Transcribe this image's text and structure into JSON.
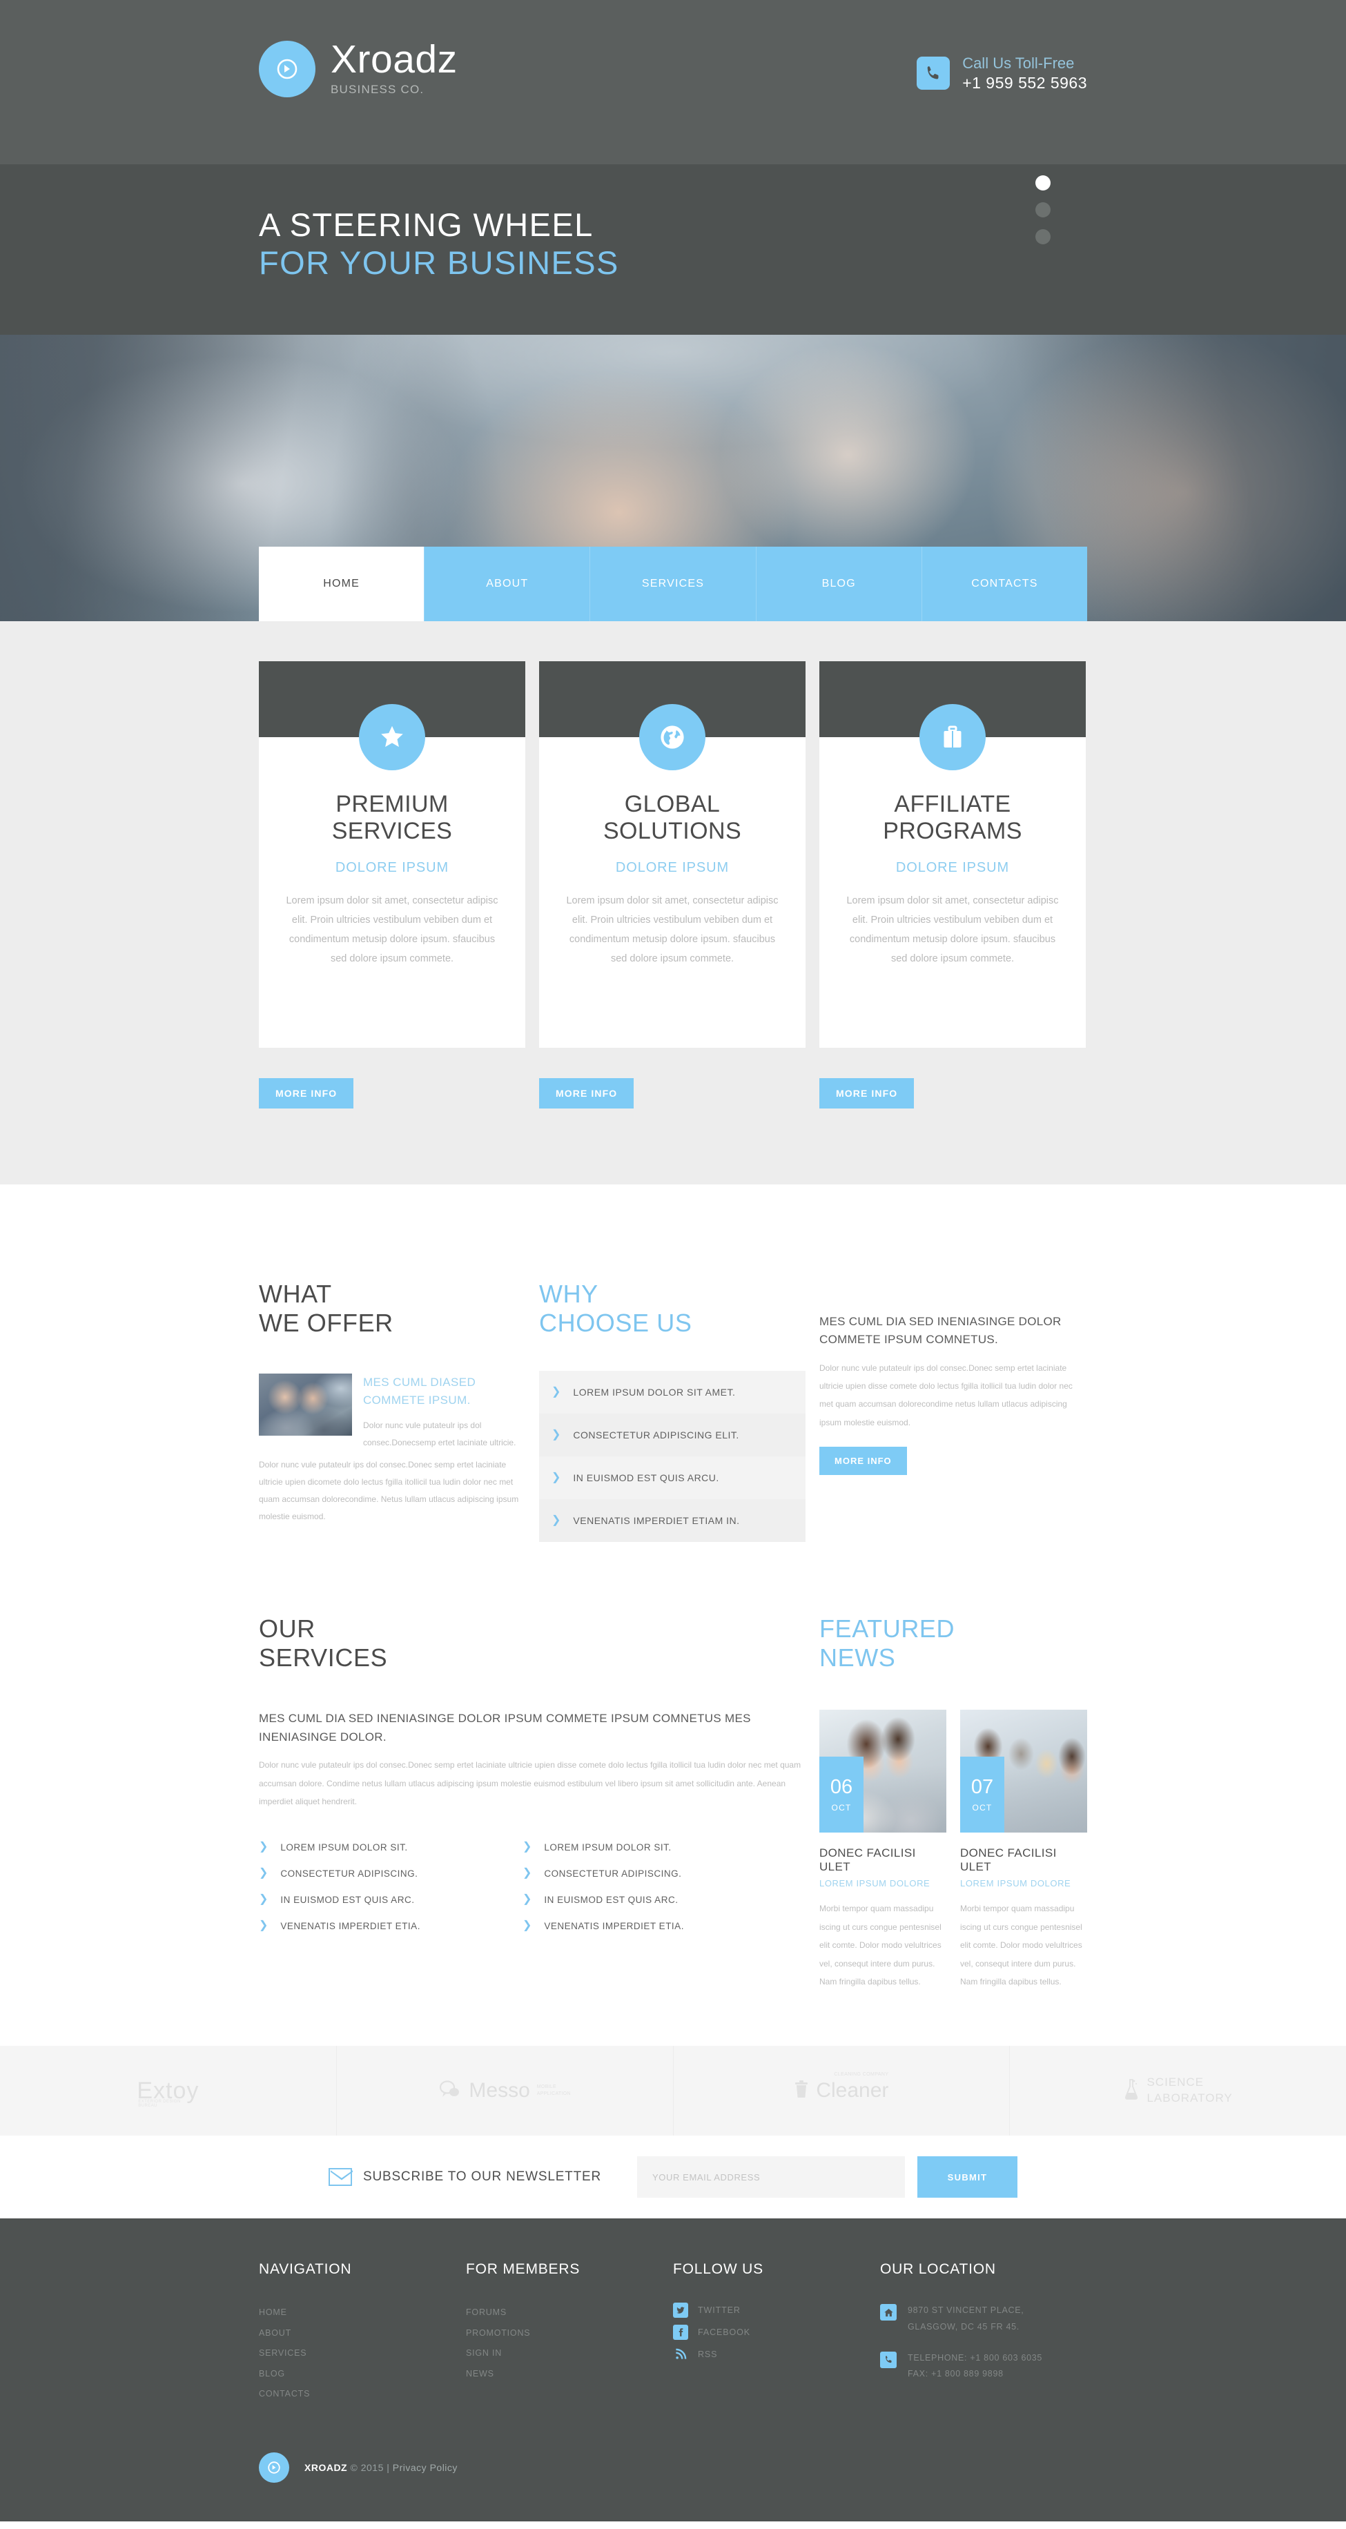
{
  "colors": {
    "accent": "#7ecbf5",
    "dark": "#4e5251",
    "header_dark": "#5b5f5e",
    "light_gray": "#ededed"
  },
  "header": {
    "brand_name": "Xroadz",
    "brand_sub": "BUSINESS CO.",
    "call_label": "Call Us Toll-Free",
    "call_number": "+1 959 552 5963"
  },
  "hero": {
    "line1": "A STEERING WHEEL",
    "line2": "FOR YOUR BUSINESS",
    "slides": 3,
    "active_slide": 1
  },
  "nav": {
    "items": [
      {
        "label": "HOME",
        "active": true
      },
      {
        "label": "ABOUT",
        "active": false
      },
      {
        "label": "SERVICES",
        "active": false
      },
      {
        "label": "BLOG",
        "active": false
      },
      {
        "label": "CONTACTS",
        "active": false
      }
    ]
  },
  "cards": [
    {
      "icon": "star-icon",
      "title_line1": "PREMIUM",
      "title_line2": "SERVICES",
      "subtitle": "DOLORE IPSUM",
      "text": "Lorem ipsum dolor sit amet, consectetur adipisc elit. Proin ultricies vestibulum vebiben dum et condimentum metusip dolore ipsum. sfaucibus sed dolore ipsum commete.",
      "button": "MORE INFO"
    },
    {
      "icon": "globe-icon",
      "title_line1": "GLOBAL",
      "title_line2": "SOLUTIONS",
      "subtitle": "DOLORE IPSUM",
      "text": "Lorem ipsum dolor sit amet, consectetur adipisc elit. Proin ultricies vestibulum vebiben dum et condimentum metusip dolore ipsum. sfaucibus sed dolore ipsum commete.",
      "button": "MORE INFO"
    },
    {
      "icon": "briefcase-icon",
      "title_line1": "AFFILIATE",
      "title_line2": "PROGRAMS",
      "subtitle": "DOLORE IPSUM",
      "text": "Lorem ipsum dolor sit amet, consectetur adipisc elit. Proin ultricies vestibulum vebiben dum et condimentum metusip dolore ipsum. sfaucibus sed dolore ipsum commete.",
      "button": "MORE INFO"
    }
  ],
  "offer": {
    "heading_line1": "WHAT",
    "heading_line2": "WE OFFER",
    "item_heading": "MES CUML DIASED COMMETE IPSUM.",
    "item_text": "Dolor nunc vule putateulr ips dol consec.Donecsemp ertet laciniate ultricie.",
    "body_text": "Dolor nunc vule putateulr ips dol consec.Donec semp ertet laciniate ultricie upien dicomete dolo lectus fgilla itollicil tua ludin dolor nec met quam accumsan dolorecondime. Netus lullam utlacus adipiscing ipsum molestie euismod."
  },
  "choose": {
    "heading_line1": "WHY",
    "heading_line2": "CHOOSE US",
    "items": [
      "LOREM IPSUM DOLOR SIT AMET.",
      "CONSECTETUR ADIPISCING ELIT.",
      "IN EUISMOD EST QUIS ARCU.",
      "VENENATIS IMPERDIET ETIAM IN."
    ]
  },
  "offer_right": {
    "heading": "MES CUML DIA SED INENIASINGE DOLOR COMMETE IPSUM COMNETUS.",
    "text": "Dolor nunc vule putateulr ips dol consec.Donec semp ertet laciniate ultricie upien disse comete dolo lectus fgilla itollicil tua ludin dolor nec met quam accumsan dolorecondime netus lullam utlacus adipiscing ipsum molestie euismod.",
    "button": "MORE INFO"
  },
  "services": {
    "heading_line1": "OUR",
    "heading_line2": "SERVICES",
    "subheading": "MES CUML DIA SED INENIASINGE DOLOR IPSUM COMMETE IPSUM COMNETUS MES INENIASINGE DOLOR.",
    "text": "Dolor nunc vule putateulr ips dol consec.Donec semp ertet laciniate ultricie upien disse comete dolo lectus fgilla itollicil tua ludin dolor nec met quam accumsan dolore. Condime netus lullam utlacus adipiscing ipsum molestie euismod estibulum vel libero ipsum sit amet sollicitudin ante. Aenean imperdiet aliquet hendrerit.",
    "col1": [
      "LOREM IPSUM DOLOR SIT.",
      "CONSECTETUR ADIPISCING.",
      "IN EUISMOD EST QUIS ARC.",
      "VENENATIS IMPERDIET ETIA."
    ],
    "col2": [
      "LOREM IPSUM DOLOR SIT.",
      "CONSECTETUR ADIPISCING.",
      "IN EUISMOD EST QUIS ARC.",
      "VENENATIS IMPERDIET ETIA."
    ]
  },
  "featured_news": {
    "heading_line1": "FEATURED",
    "heading_line2": "NEWS",
    "items": [
      {
        "day": "06",
        "month": "OCT",
        "title": "DONEC FACILISI ULET",
        "subtitle": "LOREM IPSUM DOLORE",
        "text": "Morbi tempor quam massadipu iscing ut curs congue pentesnisel elit comte. Dolor modo velultrices vel, consequt intere dum purus. Nam fringilla dapibus tellus."
      },
      {
        "day": "07",
        "month": "OCT",
        "title": "DONEC FACILISI ULET",
        "subtitle": "LOREM IPSUM DOLORE",
        "text": "Morbi tempor quam massadipu iscing ut curs congue pentesnisel elit comte. Dolor modo velultrices vel, consequt intere dum purus. Nam fringilla dapibus tellus."
      }
    ]
  },
  "partners": [
    {
      "name": "Extoy",
      "tagline": "EXTERIOR DESIGN BUREAU",
      "icon": "none"
    },
    {
      "name": "Messo",
      "tagline_l1": "MOBILE",
      "tagline_l2": "APPLICATION",
      "icon": "chat-bubble-icon"
    },
    {
      "name": "Cleaner",
      "tagline": "CLEANING COMPANY",
      "icon": "trash-icon"
    },
    {
      "name_l1": "SCIENCE",
      "name_l2": "LABORATORY",
      "icon": "flask-icon"
    }
  ],
  "newsletter": {
    "label": "SUBSCRIBE TO OUR NEWSLETTER",
    "placeholder": "YOUR EMAIL ADDRESS",
    "value": "",
    "submit": "SUBMIT"
  },
  "footer": {
    "navigation": {
      "title": "NAVIGATION",
      "links": [
        "HOME",
        "ABOUT",
        "SERVICES",
        "BLOG",
        "CONTACTS"
      ]
    },
    "members": {
      "title": "FOR MEMBERS",
      "links": [
        "FORUMS",
        "PROMOTIONS",
        "SIGN IN",
        "NEWS"
      ]
    },
    "follow": {
      "title": "FOLLOW US",
      "items": [
        {
          "label": "TWITTER",
          "icon": "twitter-icon"
        },
        {
          "label": "FACEBOOK",
          "icon": "facebook-icon"
        },
        {
          "label": "RSS",
          "icon": "rss-icon"
        }
      ]
    },
    "location": {
      "title": "OUR LOCATION",
      "address_l1": "9870 ST VINCENT PLACE,",
      "address_l2": "GLASGOW, DC 45 FR 45.",
      "phone_l1": "TELEPHONE: +1 800 603 6035",
      "phone_l2": "FAX: +1 800 889 9898"
    },
    "copyright_brand": "XROADZ",
    "copyright_rest": " © 2015 | ",
    "privacy": "Privacy Policy"
  }
}
